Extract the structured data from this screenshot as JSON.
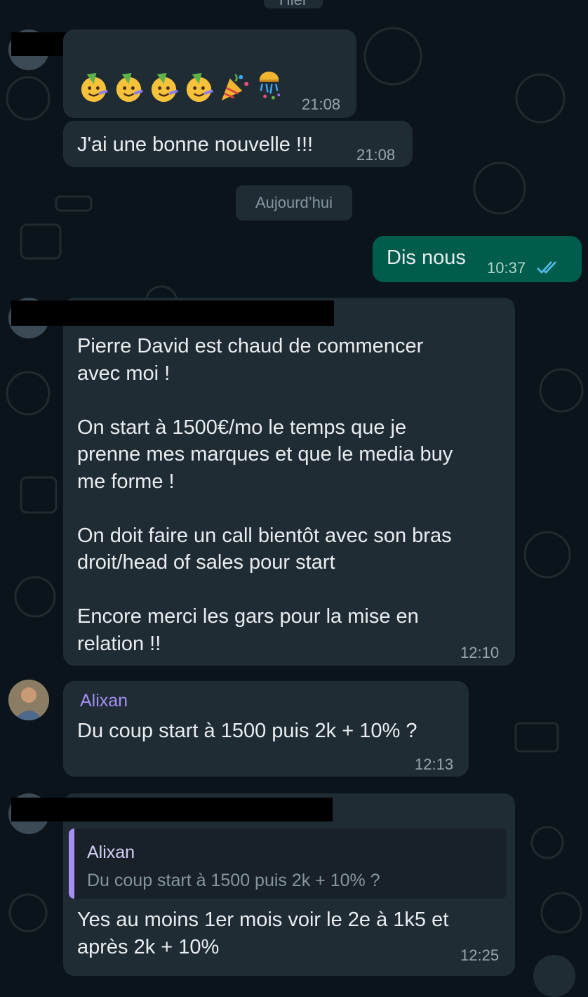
{
  "chat": {
    "top_date_chip": "Hier",
    "today_chip": "Aujourd’hui",
    "messages": [
      {
        "id": "m1",
        "type": "emoji",
        "emojis": [
          "partying-face",
          "partying-face",
          "partying-face",
          "partying-face",
          "party-popper",
          "confetti-ball"
        ],
        "time": "21:08"
      },
      {
        "id": "m2",
        "type": "text",
        "text": "J'ai une bonne nouvelle !!!",
        "time": "21:08"
      },
      {
        "id": "m3",
        "type": "outgoing",
        "text": "Dis nous",
        "time": "10:37",
        "status": "read-double-check"
      },
      {
        "id": "m4",
        "type": "text",
        "lines": [
          "Pierre David est chaud de commencer",
          "avec moi !",
          "",
          "On start à 1500€/mo le temps que je",
          "prenne mes marques et que le media buy",
          "me forme !",
          "",
          "On doit faire un call bientôt avec son bras",
          "droit/head of sales pour start",
          "",
          "Encore merci les gars pour la mise en",
          "relation !!"
        ],
        "time": "12:10"
      },
      {
        "id": "m5",
        "type": "text",
        "sender": "Alixan",
        "text": "Du coup start à 1500 puis 2k + 10% ?",
        "time": "12:13"
      },
      {
        "id": "m6",
        "type": "reply",
        "quote": {
          "sender": "Alixan",
          "text": "Du coup start à 1500 puis 2k + 10% ?"
        },
        "lines": [
          "Yes au moins 1er mois voir le 2e à 1k5 et",
          "après 2k + 10%"
        ],
        "time": "12:25"
      }
    ]
  },
  "colors": {
    "background": "#0b141a",
    "incoming_bubble": "#1f2c34",
    "outgoing_bubble": "#005c4b",
    "sender_name": "#a68ef5",
    "read_ticks": "#53bdeb"
  }
}
